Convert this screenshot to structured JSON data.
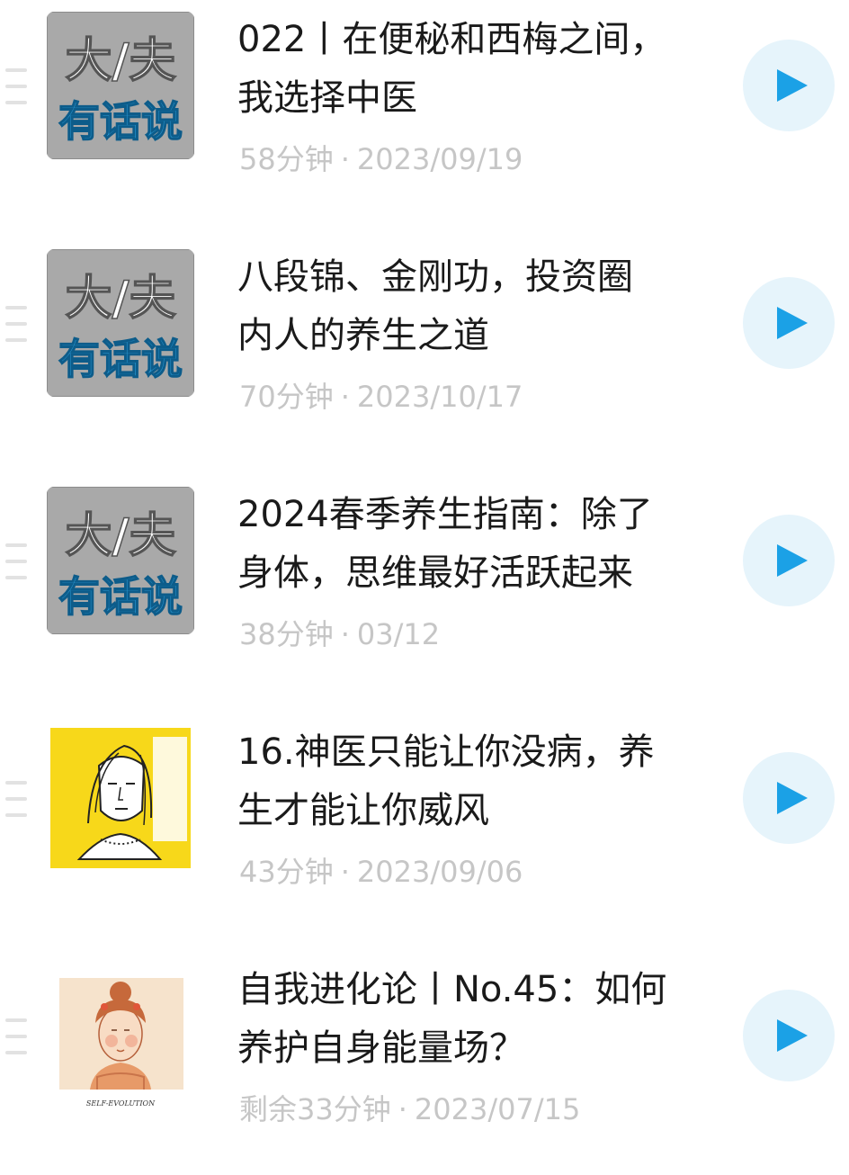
{
  "accent_color": "#1ba1e6",
  "items": [
    {
      "title_line1": "022丨在便秘和西梅之间，",
      "title_line2": "我选择中医",
      "duration": "58分钟",
      "date": "2023/09/19",
      "cover": "dafu",
      "cover_text_top": "大/夫",
      "cover_text_bottom": "有话说",
      "play_icon": "play-icon"
    },
    {
      "title_line1": "八段锦、金刚功，投资圈",
      "title_line2": "内人的养生之道",
      "duration": "70分钟",
      "date": "2023/10/17",
      "cover": "dafu",
      "cover_text_top": "大/夫",
      "cover_text_bottom": "有话说",
      "play_icon": "play-icon"
    },
    {
      "title_line1": "2024春季养生指南：除了",
      "title_line2": "身体，思维最好活跃起来",
      "duration": "38分钟",
      "date": "03/12",
      "cover": "dafu",
      "cover_text_top": "大/夫",
      "cover_text_bottom": "有话说",
      "play_icon": "play-icon"
    },
    {
      "title_line1": "16.神医只能让你没病，养",
      "title_line2": "生才能让你威风",
      "duration": "43分钟",
      "date": "2023/09/06",
      "cover": "sketch-yellow",
      "play_icon": "play-icon"
    },
    {
      "title_line1": "自我进化论丨No.45：如何",
      "title_line2": "养护自身能量场？",
      "duration": "剩余33分钟",
      "date": "2023/07/15",
      "cover": "self-evolution",
      "cover_caption": "SELF-EVOLUTION",
      "play_icon": "play-icon"
    }
  ]
}
